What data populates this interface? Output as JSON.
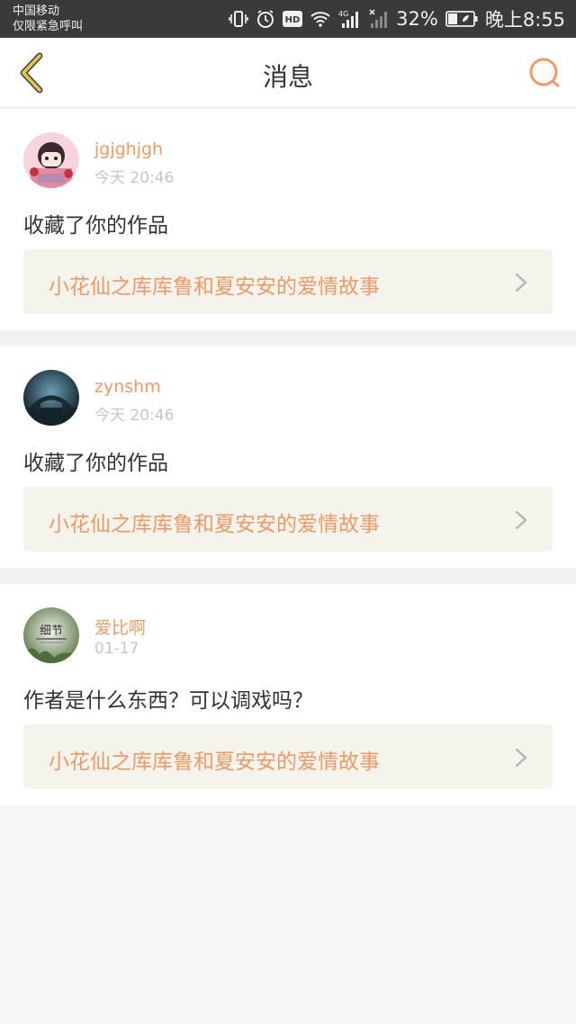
{
  "status_bar": {
    "carrier": "中国移动",
    "emergency": "仅限紧急呼叫",
    "network": "4G",
    "battery": "32%",
    "time": "晚上8:55",
    "icons": [
      "vibrate-icon",
      "alarm-icon",
      "hd-icon",
      "wifi-icon",
      "signal-icon",
      "no-signal-icon",
      "battery-icon"
    ]
  },
  "header": {
    "title": "消息",
    "back_icon": "chevron-left-icon",
    "search_icon": "search-icon"
  },
  "colors": {
    "accent": "#ee9a66",
    "back_icon": "#e6c64a",
    "card_link_bg": "#f4f3ec"
  },
  "messages": [
    {
      "username": "jgjghjgh",
      "time": "今天 20:46",
      "text": "收藏了你的作品",
      "work_title": "小花仙之库库鲁和夏安安的爱情故事"
    },
    {
      "username": "zynshm",
      "time": "今天 20:46",
      "text": "收藏了你的作品",
      "work_title": "小花仙之库库鲁和夏安安的爱情故事"
    },
    {
      "username": "爱比啊",
      "time": "01-17",
      "text": "作者是什么东西？可以调戏吗？",
      "work_title": "小花仙之库库鲁和夏安安的爱情故事",
      "avatar_text": "细节"
    }
  ]
}
